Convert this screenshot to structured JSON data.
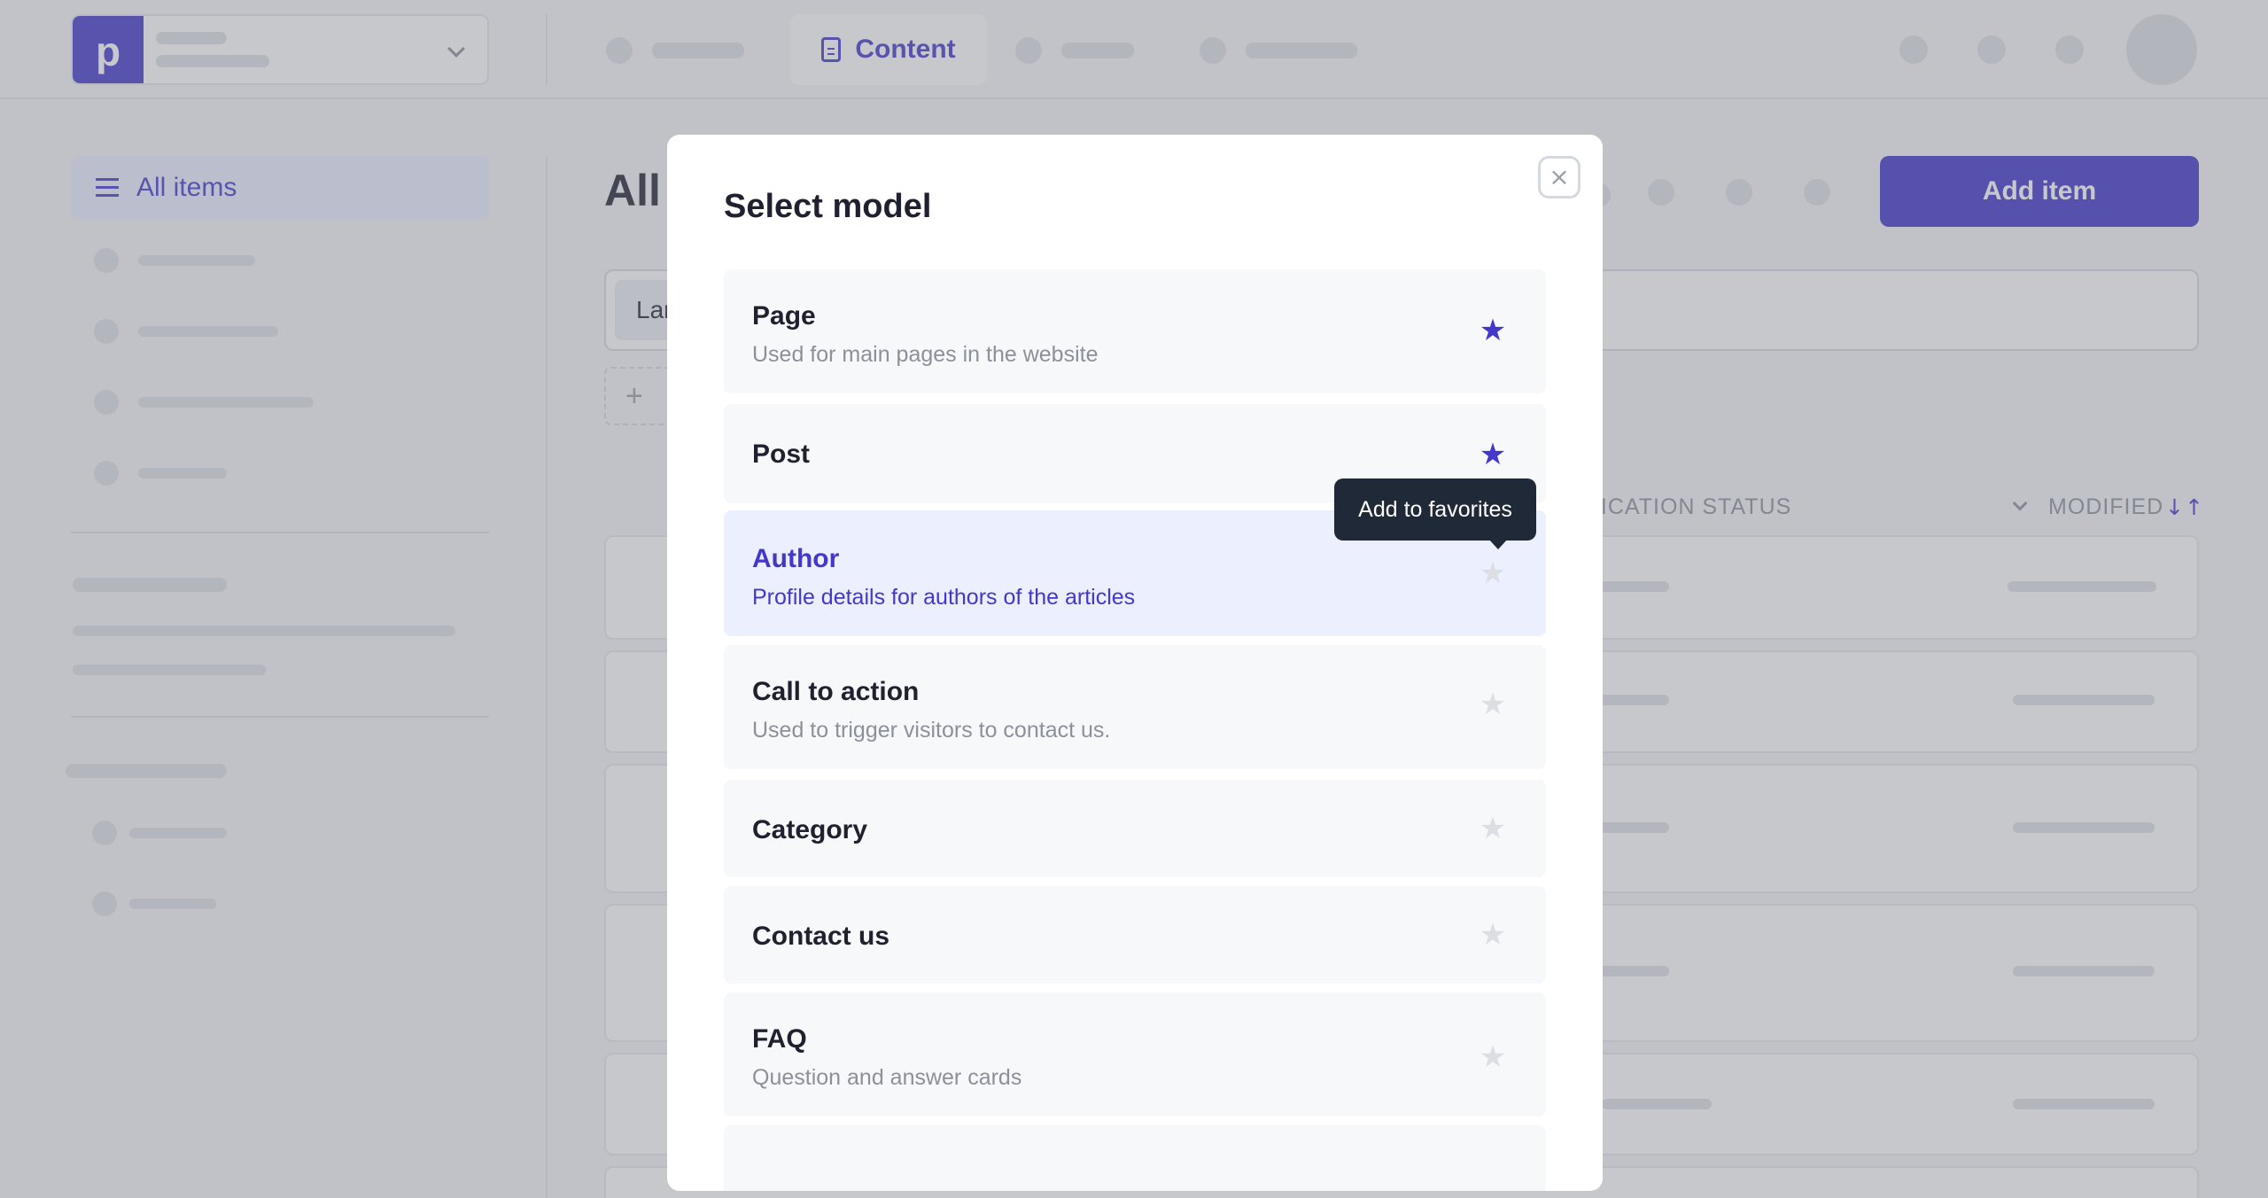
{
  "topbar": {
    "active_tab": "Content"
  },
  "sidebar": {
    "active_item": "All items"
  },
  "main": {
    "title_partial": "All",
    "add_button": "Add item",
    "filter_chip_partial": "Lar",
    "add_filter_icon": "+",
    "columns": {
      "status": "LICATION STATUS",
      "modified": "MODIFIED",
      "sort_icon": "↓↑"
    }
  },
  "modal": {
    "title": "Select model",
    "close_icon": "×",
    "tooltip": "Add to favorites",
    "models": [
      {
        "name": "Page",
        "description": "Used for main pages in the website",
        "favorite": true
      },
      {
        "name": "Post",
        "description": "",
        "favorite": true
      },
      {
        "name": "Author",
        "description": "Profile details for authors of the articles",
        "favorite": false
      },
      {
        "name": "Call to action",
        "description": "Used to trigger visitors to contact us.",
        "favorite": false
      },
      {
        "name": "Category",
        "description": "",
        "favorite": false
      },
      {
        "name": "Contact us",
        "description": "",
        "favorite": false
      },
      {
        "name": "FAQ",
        "description": "Question and answer cards",
        "favorite": false
      }
    ],
    "star_glyph": "★"
  },
  "colors": {
    "accent": "#4338ca",
    "tooltip": "#1f2937",
    "overlay": "rgba(120,123,133,0.42)"
  }
}
